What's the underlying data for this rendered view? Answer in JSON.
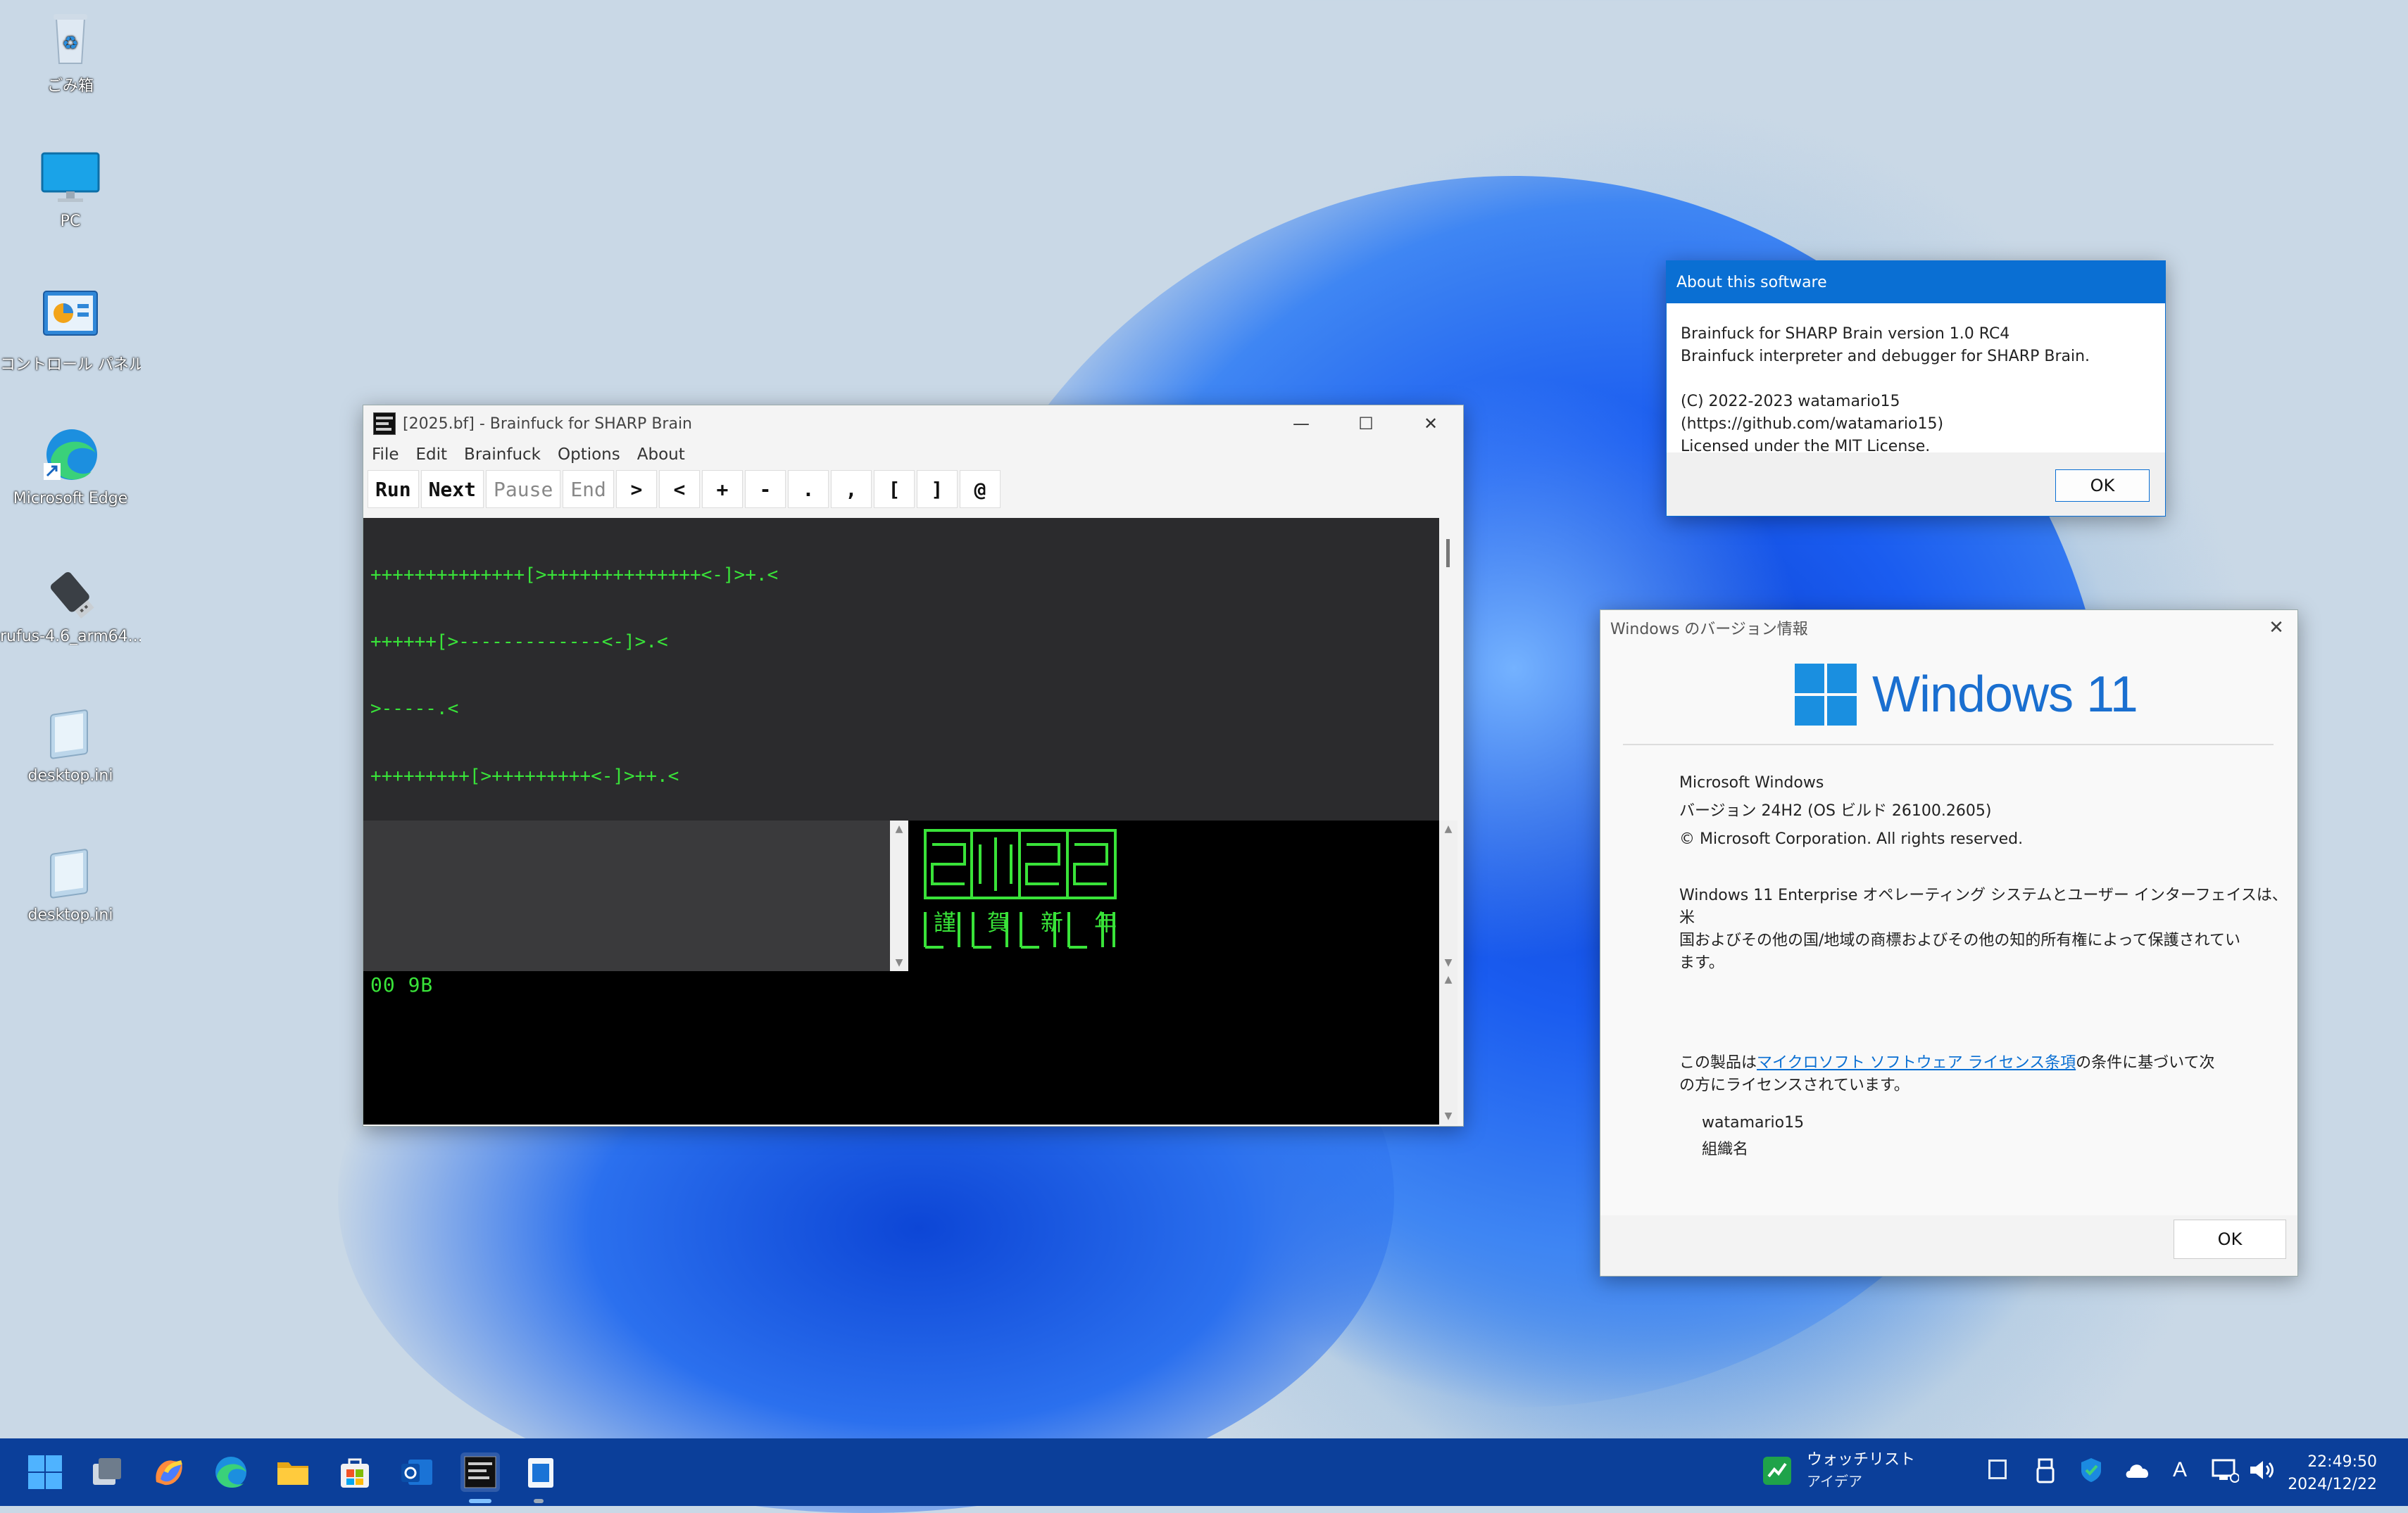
{
  "desktop": {
    "icons": [
      {
        "label": "ごみ箱",
        "icon": "recycle-bin-icon"
      },
      {
        "label": "PC",
        "icon": "pc-monitor-icon"
      },
      {
        "label": "コントロール パネル",
        "icon": "control-panel-icon"
      },
      {
        "label": "Microsoft Edge",
        "icon": "edge-icon"
      },
      {
        "label": "rufus-4.6_arm64...",
        "icon": "usb-drive-icon"
      },
      {
        "label": "desktop.ini",
        "icon": "notepad-file-icon"
      },
      {
        "label": "desktop.ini",
        "icon": "notepad-file-icon"
      }
    ]
  },
  "bf_window": {
    "title": "[2025.bf] - Brainfuck for SHARP Brain",
    "menu": [
      "File",
      "Edit",
      "Brainfuck",
      "Options",
      "About"
    ],
    "toolbar": [
      "Run",
      "Next",
      "Pause",
      "End",
      ">",
      "<",
      "+",
      "-",
      ".",
      ",",
      "[",
      "]",
      "@"
    ],
    "code_lines": [
      "++++++++++++++[>++++++++++++++<-]>+.<",
      "++++++[>-------------<-]>.<",
      ">-----.<",
      "+++++++++[>+++++++++<-]>++.<",
      "++++++[>-------------<-]>.<",
      "+++[>------<-]>-.<",
      "++++++++[>++++++++++++<-]>+.<",
      "++++++[>-------------<-]>.<",
      "+++++[>++++++<-]>+.<",
      "+++++[>+++++++++<-]>++.<",
      "++++++[>-------------<-]>.<",
      "+++[>------<-]>-.<",
      "++++++++[>++++++++++++<-]>+.<",
      "++++++[>-------------<-]>.<"
    ],
    "output_kanji": [
      "謹",
      "賀",
      "新",
      "年"
    ],
    "memory_readout": "00 9B"
  },
  "about_dialog": {
    "title": "About this software",
    "lines": [
      "Brainfuck for SHARP Brain version 1.0 RC4",
      "Brainfuck interpreter and debugger for SHARP Brain.",
      "",
      "(C) 2022-2023 watamario15 (https://github.com/watamario15)",
      "Licensed under the MIT License."
    ],
    "ok": "OK"
  },
  "winver": {
    "title": "Windows のバージョン情報",
    "logo_text": "Windows 11",
    "product": "Microsoft Windows",
    "version": "バージョン 24H2 (OS ビルド 26100.2605)",
    "copyright": "© Microsoft Corporation. All rights reserved.",
    "legal_1": "Windows 11 Enterprise オペレーティング システムとユーザー インターフェイスは、米",
    "legal_2": "国およびその他の国/地域の商標およびその他の知的所有権によって保護されてい",
    "legal_3": "ます。",
    "license_pre": "この製品は",
    "license_link": "マイクロソフト ソフトウェア ライセンス条項",
    "license_post": "の条件に基づいて次",
    "license_line2": "の方にライセンスされています。",
    "user": "watamario15",
    "org": "組織名",
    "ok": "OK"
  },
  "taskbar": {
    "widget_title": "ウォッチリスト",
    "widget_sub": "アイデア",
    "time": "22:49:50",
    "date": "2024/12/22",
    "ime": "A"
  },
  "colors": {
    "accent": "#0a6fd3",
    "terminal_green": "#39e339",
    "editor_bg": "#2b2b2d",
    "taskbar": "#0b3f9a"
  }
}
